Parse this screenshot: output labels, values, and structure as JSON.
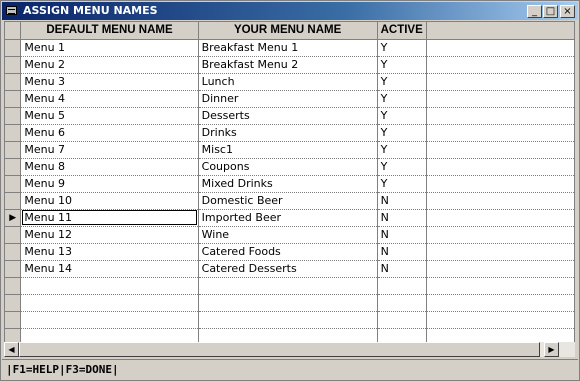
{
  "window": {
    "title": "ASSIGN MENU NAMES",
    "minimize_glyph": "_",
    "maximize_glyph": "□",
    "close_glyph": "×"
  },
  "grid": {
    "columns": [
      "DEFAULT MENU NAME",
      "YOUR MENU NAME",
      "ACTIVE"
    ],
    "current_row_indicator": "▶",
    "rows": [
      {
        "default": "Menu 1",
        "custom": "Breakfast Menu 1",
        "active": "Y"
      },
      {
        "default": "Menu 2",
        "custom": "Breakfast Menu 2",
        "active": "Y"
      },
      {
        "default": "Menu 3",
        "custom": "Lunch",
        "active": "Y"
      },
      {
        "default": "Menu 4",
        "custom": "Dinner",
        "active": "Y"
      },
      {
        "default": "Menu 5",
        "custom": "Desserts",
        "active": "Y"
      },
      {
        "default": "Menu 6",
        "custom": "Drinks",
        "active": "Y"
      },
      {
        "default": "Menu 7",
        "custom": "Misc1",
        "active": "Y"
      },
      {
        "default": "Menu 8",
        "custom": "Coupons",
        "active": "Y"
      },
      {
        "default": "Menu 9",
        "custom": "Mixed Drinks",
        "active": "Y"
      },
      {
        "default": "Menu 10",
        "custom": "Domestic Beer",
        "active": "N"
      },
      {
        "default": "Menu 11",
        "custom": "Imported Beer",
        "active": "N"
      },
      {
        "default": "Menu 12",
        "custom": "Wine",
        "active": "N"
      },
      {
        "default": "Menu 13",
        "custom": "Catered Foods",
        "active": "N"
      },
      {
        "default": "Menu 14",
        "custom": "Catered Desserts",
        "active": "N"
      }
    ],
    "current_row": 10
  },
  "scrollbar": {
    "left_arrow": "◀",
    "right_arrow": "▶"
  },
  "status": {
    "text": "|F1=HELP|F3=DONE|"
  }
}
